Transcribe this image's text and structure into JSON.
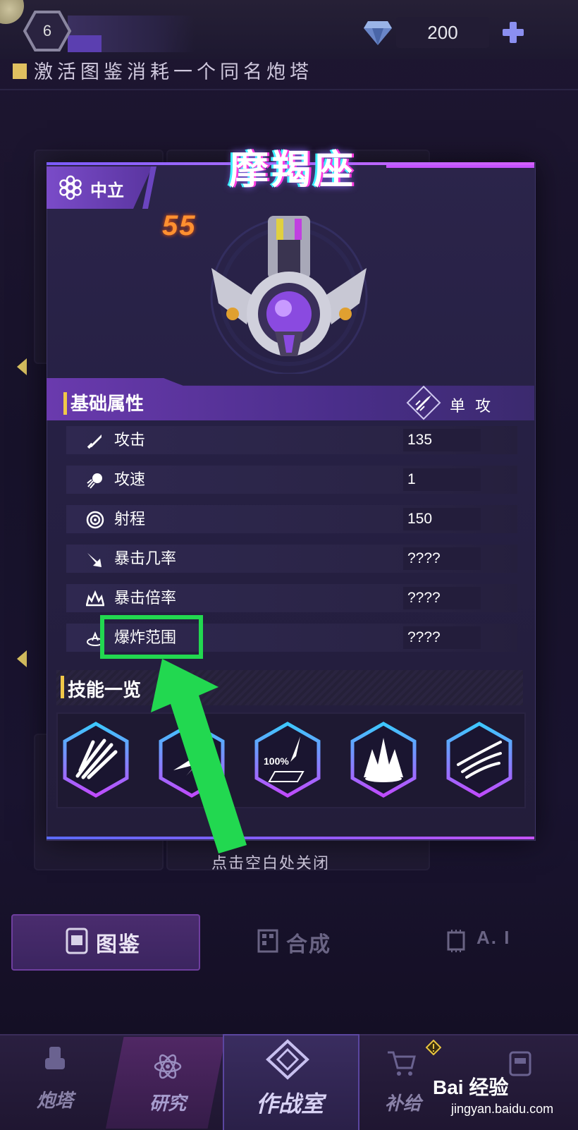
{
  "top_bar": {
    "level": "6",
    "gems": "200"
  },
  "hint": "激活图鉴消耗一个同名炮塔",
  "modal": {
    "faction": "中立",
    "title": "摩羯座",
    "level_badge": "55",
    "basic_section": "基础属性",
    "attack_type": "单 攻",
    "stats": [
      {
        "label": "攻击",
        "value": "135",
        "icon": "sword-icon"
      },
      {
        "label": "攻速",
        "value": "1",
        "icon": "speed-icon"
      },
      {
        "label": "射程",
        "value": "150",
        "icon": "target-icon"
      },
      {
        "label": "暴击几率",
        "value": "????",
        "icon": "crit-chance-icon"
      },
      {
        "label": "暴击倍率",
        "value": "????",
        "icon": "crit-multiplier-icon"
      },
      {
        "label": "爆炸范围",
        "value": "????",
        "icon": "explosion-range-icon"
      }
    ],
    "skills_section": "技能一览",
    "skills": [
      {
        "icon": "slash-burst-icon"
      },
      {
        "icon": "lightning-icon"
      },
      {
        "icon": "full-charge-icon",
        "text": "100%"
      },
      {
        "icon": "ground-blast-icon"
      },
      {
        "icon": "multi-slash-icon"
      }
    ],
    "close_hint": "点击空白处关闭"
  },
  "tabs": [
    {
      "label": "图鉴",
      "active": true
    },
    {
      "label": "合成",
      "active": false
    },
    {
      "label": "A. I",
      "active": false
    }
  ],
  "bottom_nav": [
    {
      "label": "炮塔"
    },
    {
      "label": "研究"
    },
    {
      "label": "作战室"
    },
    {
      "label": "补给"
    }
  ],
  "watermark": {
    "main": "Bai 经验",
    "sub": "jingyan.baidu.com"
  },
  "colors": {
    "accent": "#8a5cff",
    "highlight": "#22d850",
    "badge": "#ff9030",
    "gold": "#f0c848"
  }
}
